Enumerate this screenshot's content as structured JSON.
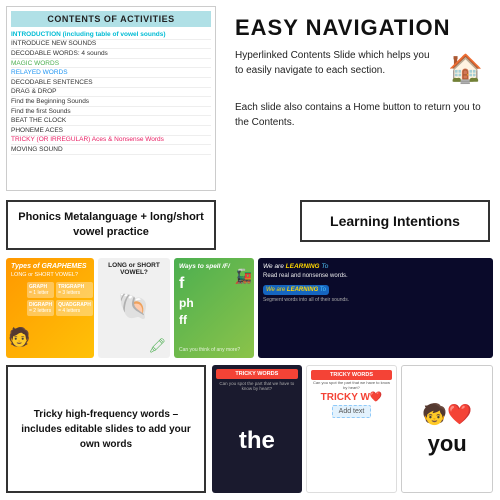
{
  "contents": {
    "title": "CONTENTS OF ACTIVITIES",
    "items": [
      {
        "text": "INTRODUCTION (including table of vowel sounds)",
        "class": "highlight"
      },
      {
        "text": "INTRODUCE NEW SOUNDS",
        "class": ""
      },
      {
        "text": "DECODABLE WORDS: 4 sounds",
        "class": ""
      },
      {
        "text": "MAGIC WORDS",
        "class": ""
      },
      {
        "text": "RELAYED WORDS",
        "class": ""
      },
      {
        "text": "DECODABLE SENTENCES",
        "class": ""
      },
      {
        "text": "DRAG & DROP",
        "class": ""
      },
      {
        "text": "Find the Beginning Sounds",
        "class": ""
      },
      {
        "text": "Find the first Sounds",
        "class": ""
      },
      {
        "text": "BEAT THE CLOCK",
        "class": ""
      },
      {
        "text": "PHONEME ACES",
        "class": ""
      },
      {
        "text": "TRICKY (OR IRREGULAR) Aces & Nonsense Words",
        "class": ""
      },
      {
        "text": "MOVING SOUND",
        "class": ""
      }
    ]
  },
  "nav": {
    "title": "EASY NAVIGATION",
    "body1": "Hyperlinked Contents Slide which helps you to easily navigate to each section.",
    "body2": "Each slide also contains a Home button to return you to the Contents.",
    "house_icon": "🏠"
  },
  "phonics": {
    "text": "Phonics Metalanguage + long/short vowel practice"
  },
  "learning": {
    "title": "Learning Intentions"
  },
  "slides": [
    {
      "type": "graphemes",
      "title": "Types of GRAPHEMES",
      "subtitle": "LONG or SHORT VOWEL?",
      "cells": [
        {
          "label": "GRAPH",
          "sub": "= 1 letter"
        },
        {
          "label": "TRIGRAPH",
          "sub": "= 3 letters"
        },
        {
          "label": "DIGRAPH",
          "sub": "= 2 letters"
        },
        {
          "label": "QUADGRAPH",
          "sub": "= 4 letters"
        }
      ]
    },
    {
      "type": "vowel",
      "title": "LONG or SHORT VOWEL?",
      "icon": "🐚"
    },
    {
      "type": "fspell",
      "title": "Ways to spell /F/",
      "letters": [
        "f",
        "ph",
        "ff"
      ],
      "caption": "Can you think of any more?"
    },
    {
      "type": "learning1",
      "head_we": "We are",
      "head_learning": "LEARNING TO",
      "body": "Read real and nonsense words."
    },
    {
      "type": "learning2",
      "head_we": "We are",
      "head_learning": "LEARNING TO",
      "body": "Segment words into all of their sounds."
    }
  ],
  "bottom": {
    "desc": "Tricky high-frequency words – includes editable slides to add your own words",
    "slides": [
      {
        "type": "tricky-dark",
        "header": "TRICKY WORDS",
        "sub": "Can you spot the part that we have to know by heart?",
        "word": "the"
      },
      {
        "type": "tricky-light",
        "header": "TRICKY WORDS",
        "sub": "Can you spot the part that we have to know by heart?",
        "word": "TRICKY W❤️",
        "addtext": "Add text"
      }
    ],
    "word_you": "you"
  }
}
